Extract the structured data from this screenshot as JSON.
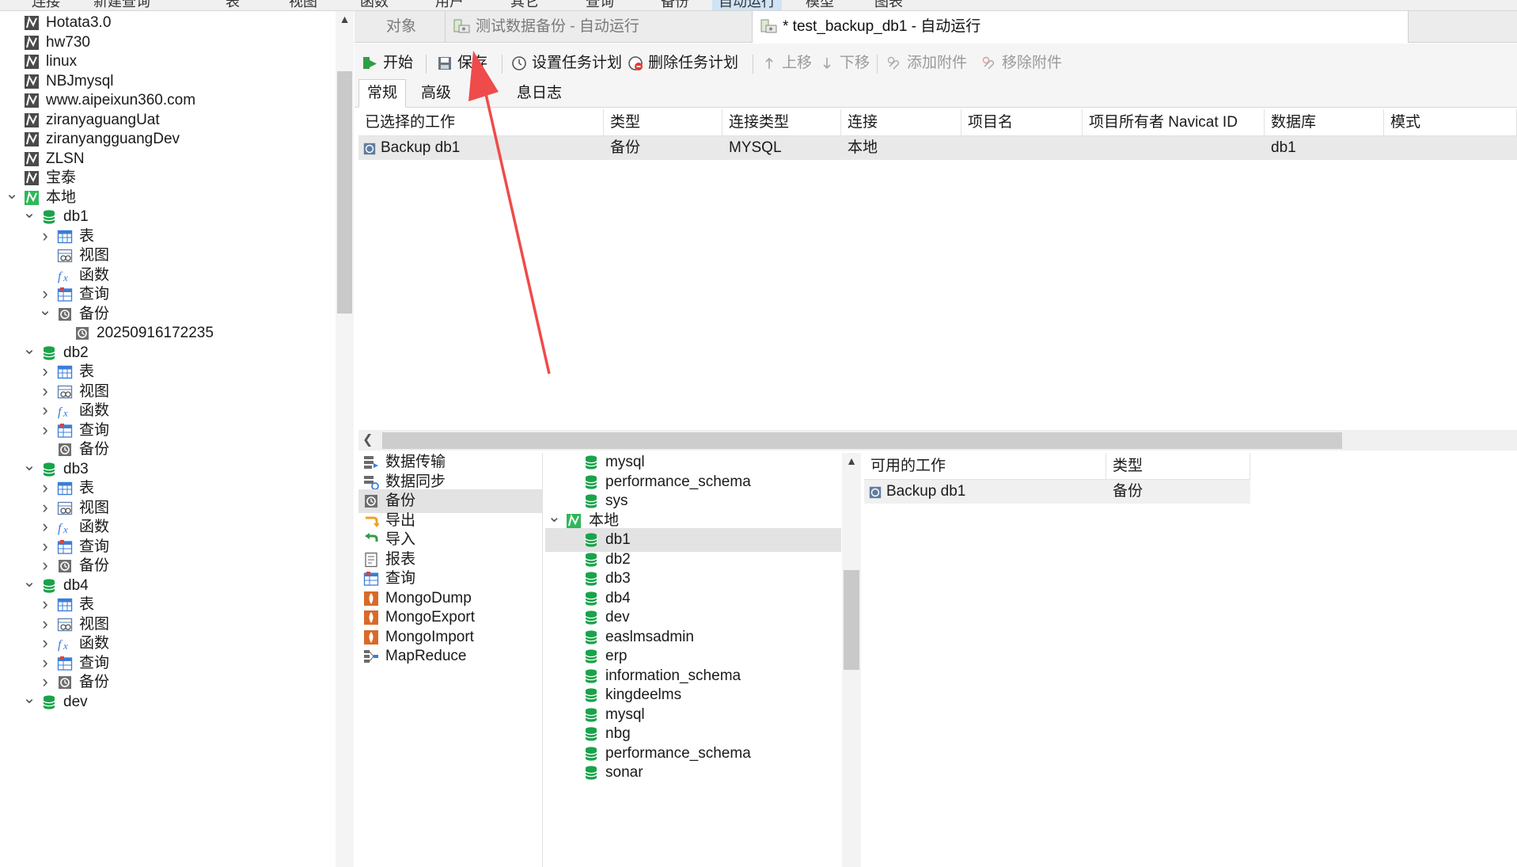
{
  "menu": {
    "items": [
      "连接",
      "新建查询",
      "表",
      "视图",
      "函数",
      "用户",
      "其它",
      "查询",
      "备份",
      "自动运行",
      "模型",
      "图表"
    ],
    "active_index": 9
  },
  "sidebar": {
    "items": [
      {
        "label": "Hotata3.0",
        "icon": "connection-icon",
        "level": 0,
        "chevron": ""
      },
      {
        "label": "hw730",
        "icon": "connection-icon",
        "level": 0,
        "chevron": ""
      },
      {
        "label": "linux",
        "icon": "connection-icon",
        "level": 0,
        "chevron": ""
      },
      {
        "label": "NBJmysql",
        "icon": "connection-icon",
        "level": 0,
        "chevron": ""
      },
      {
        "label": "www.aipeixun360.com",
        "icon": "connection-icon",
        "level": 0,
        "chevron": ""
      },
      {
        "label": "ziranyaguangUat",
        "icon": "connection-icon",
        "level": 0,
        "chevron": ""
      },
      {
        "label": "ziranyangguangDev",
        "icon": "connection-icon",
        "level": 0,
        "chevron": ""
      },
      {
        "label": "ZLSN",
        "icon": "connection-icon",
        "level": 0,
        "chevron": ""
      },
      {
        "label": "宝泰",
        "icon": "connection-icon",
        "level": 0,
        "chevron": ""
      },
      {
        "label": "本地",
        "icon": "connection-open-icon",
        "level": 0,
        "chevron": "down"
      },
      {
        "label": "db1",
        "icon": "database-icon",
        "level": 1,
        "chevron": "down"
      },
      {
        "label": "表",
        "icon": "table-icon",
        "level": 2,
        "chevron": "right"
      },
      {
        "label": "视图",
        "icon": "view-icon",
        "level": 2,
        "chevron": ""
      },
      {
        "label": "函数",
        "icon": "function-icon",
        "level": 2,
        "chevron": ""
      },
      {
        "label": "查询",
        "icon": "query-icon",
        "level": 2,
        "chevron": "right"
      },
      {
        "label": "备份",
        "icon": "backup-icon",
        "level": 2,
        "chevron": "down"
      },
      {
        "label": "20250916172235",
        "icon": "backup-file-icon",
        "level": 3,
        "chevron": ""
      },
      {
        "label": "db2",
        "icon": "database-icon",
        "level": 1,
        "chevron": "down"
      },
      {
        "label": "表",
        "icon": "table-icon",
        "level": 2,
        "chevron": "right"
      },
      {
        "label": "视图",
        "icon": "view-icon",
        "level": 2,
        "chevron": "right"
      },
      {
        "label": "函数",
        "icon": "function-icon",
        "level": 2,
        "chevron": "right"
      },
      {
        "label": "查询",
        "icon": "query-icon",
        "level": 2,
        "chevron": "right"
      },
      {
        "label": "备份",
        "icon": "backup-icon",
        "level": 2,
        "chevron": ""
      },
      {
        "label": "db3",
        "icon": "database-icon",
        "level": 1,
        "chevron": "down"
      },
      {
        "label": "表",
        "icon": "table-icon",
        "level": 2,
        "chevron": "right"
      },
      {
        "label": "视图",
        "icon": "view-icon",
        "level": 2,
        "chevron": "right"
      },
      {
        "label": "函数",
        "icon": "function-icon",
        "level": 2,
        "chevron": "right"
      },
      {
        "label": "查询",
        "icon": "query-icon",
        "level": 2,
        "chevron": "right"
      },
      {
        "label": "备份",
        "icon": "backup-icon",
        "level": 2,
        "chevron": "right"
      },
      {
        "label": "db4",
        "icon": "database-icon",
        "level": 1,
        "chevron": "down"
      },
      {
        "label": "表",
        "icon": "table-icon",
        "level": 2,
        "chevron": "right"
      },
      {
        "label": "视图",
        "icon": "view-icon",
        "level": 2,
        "chevron": "right"
      },
      {
        "label": "函数",
        "icon": "function-icon",
        "level": 2,
        "chevron": "right"
      },
      {
        "label": "查询",
        "icon": "query-icon",
        "level": 2,
        "chevron": "right"
      },
      {
        "label": "备份",
        "icon": "backup-icon",
        "level": 2,
        "chevron": "right"
      },
      {
        "label": "dev",
        "icon": "database-icon",
        "level": 1,
        "chevron": "down"
      }
    ]
  },
  "tabs": [
    {
      "label": "对象",
      "icon": "",
      "active": false
    },
    {
      "label": "测试数据备份 - 自动运行",
      "icon": "automation-icon",
      "active": false
    },
    {
      "label": "* test_backup_db1 - 自动运行",
      "icon": "automation-icon",
      "active": true
    }
  ],
  "toolbar": {
    "start_label": "开始",
    "save_label": "保存",
    "set_schedule_label": "设置任务计划",
    "delete_schedule_label": "删除任务计划",
    "move_up_label": "上移",
    "move_down_label": "下移",
    "add_attachment_label": "添加附件",
    "remove_attachment_label": "移除附件"
  },
  "subtabs": [
    "常规",
    "高级",
    "息日志"
  ],
  "selected_jobs": {
    "columns": [
      "已选择的工作",
      "类型",
      "连接类型",
      "连接",
      "项目名",
      "项目所有者 Navicat ID",
      "数据库",
      "模式"
    ],
    "rows": [
      [
        "Backup db1",
        "备份",
        "MYSQL",
        "本地",
        "",
        "",
        "db1",
        ""
      ]
    ]
  },
  "job_types": [
    {
      "label": "数据传输",
      "icon": "data-transfer-icon"
    },
    {
      "label": "数据同步",
      "icon": "data-sync-icon"
    },
    {
      "label": "备份",
      "icon": "backup-icon",
      "selected": true
    },
    {
      "label": "导出",
      "icon": "export-icon"
    },
    {
      "label": "导入",
      "icon": "import-icon"
    },
    {
      "label": "报表",
      "icon": "report-icon"
    },
    {
      "label": "查询",
      "icon": "query-icon"
    },
    {
      "label": "MongoDump",
      "icon": "mongo-icon"
    },
    {
      "label": "MongoExport",
      "icon": "mongo-icon"
    },
    {
      "label": "MongoImport",
      "icon": "mongo-icon"
    },
    {
      "label": "MapReduce",
      "icon": "mapreduce-icon"
    }
  ],
  "db_list": [
    {
      "label": "mysql",
      "icon": "database-icon",
      "chevron": ""
    },
    {
      "label": "performance_schema",
      "icon": "database-icon",
      "chevron": ""
    },
    {
      "label": "sys",
      "icon": "database-icon",
      "chevron": ""
    },
    {
      "label": "本地",
      "icon": "connection-open-icon",
      "chevron": "down",
      "root": true
    },
    {
      "label": "db1",
      "icon": "database-icon",
      "chevron": "",
      "selected": true
    },
    {
      "label": "db2",
      "icon": "database-icon",
      "chevron": ""
    },
    {
      "label": "db3",
      "icon": "database-icon",
      "chevron": ""
    },
    {
      "label": "db4",
      "icon": "database-icon",
      "chevron": ""
    },
    {
      "label": "dev",
      "icon": "database-icon",
      "chevron": ""
    },
    {
      "label": "easlmsadmin",
      "icon": "database-icon",
      "chevron": ""
    },
    {
      "label": "erp",
      "icon": "database-icon",
      "chevron": ""
    },
    {
      "label": "information_schema",
      "icon": "database-icon",
      "chevron": ""
    },
    {
      "label": "kingdeelms",
      "icon": "database-icon",
      "chevron": ""
    },
    {
      "label": "mysql",
      "icon": "database-icon",
      "chevron": ""
    },
    {
      "label": "nbg",
      "icon": "database-icon",
      "chevron": ""
    },
    {
      "label": "performance_schema",
      "icon": "database-icon",
      "chevron": ""
    },
    {
      "label": "sonar",
      "icon": "database-icon",
      "chevron": ""
    }
  ],
  "available_jobs": {
    "columns": [
      "可用的工作",
      "类型"
    ],
    "rows": [
      [
        "Backup db1",
        "备份"
      ]
    ]
  },
  "colors": {
    "db_green": "#1aa34a",
    "annotation_red": "#ef4b4b",
    "selection_gray": "#e3e3e3"
  }
}
